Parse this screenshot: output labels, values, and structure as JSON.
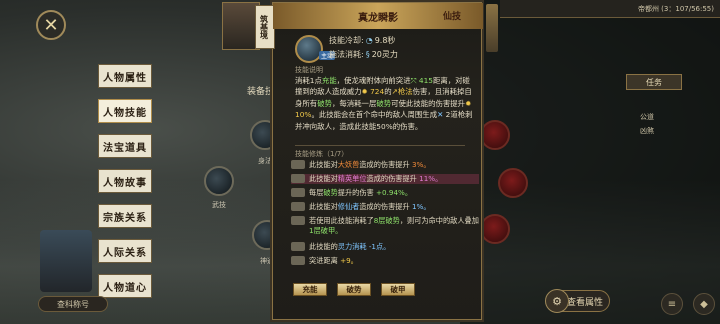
{
  "close_icon": "✕",
  "tabs": [
    "人物属性",
    "人物技能",
    "法宝道具",
    "人物故事",
    "宗族关系",
    "人际关系",
    "人物道心"
  ],
  "equip_label": "装备技",
  "left_skills": [
    {
      "label": "身法"
    },
    {
      "label": "武技"
    },
    {
      "label": "神通"
    }
  ],
  "portrait_label": "查科称号",
  "topbar_text": "帝都州 (3：107/56:55)",
  "task_label": "任务",
  "side_items": [
    "公道",
    "凶煞"
  ],
  "view_attr_label": "查看属性",
  "popup": {
    "realm": "筑基境",
    "title": "真龙瞬影",
    "tier": "仙技",
    "cooldown_label": "技能冷却:",
    "cooldown_value": "9.8秒",
    "cost_label": "施法消耗:",
    "cost_value": "20灵力",
    "active_tag": "主动",
    "desc_title": "技能说明",
    "desc": {
      "p1": "消耗1点",
      "p2": "充能",
      "p3": "，使龙魂附体向前突进",
      "p4": "415",
      "p5": "距离，对碰撞到的敌人造成威力",
      "p6": "724",
      "p7": "的",
      "p8": "枪法",
      "p9": "伤害，且消耗掉自身所有",
      "p10": "破势",
      "p11": "，每消耗一层",
      "p12": "破势",
      "p13": "可使此技能的伤害提升",
      "p14": "10%",
      "p15": "。此技能会在首个命中的敌人周围生成",
      "p16": "2",
      "p17": "道枪刺并冲向敌人，造成此技能50%的伤害。"
    },
    "ins_title": "技能修炼（1/7）",
    "inscriptions": [
      {
        "pre": "此技能对",
        "key": "大妖兽",
        "post": "造成的伤害提升",
        "val": "3%。",
        "cls": "o"
      },
      {
        "pre": "此技能对",
        "key": "精英单位",
        "post": "造成的伤害提升",
        "val": "11%。",
        "cls": "m",
        "hl": true
      },
      {
        "pre": "每层",
        "key": "破势",
        "post": "提升的伤害",
        "val": "+0.94%。",
        "cls": "g"
      },
      {
        "pre": "此技能对",
        "key": "修仙者",
        "post": "造成的伤害提升",
        "val": "1%。",
        "cls": "b"
      },
      {
        "pre": "若使用此技能消耗了",
        "key": "8层破势",
        "post": "，则可为命中的敌人叠加",
        "val": "1层破甲。",
        "cls": "g"
      },
      {
        "pre": "此技能的",
        "key": "灵力消耗",
        "post": "",
        "val": "-1点。",
        "cls": "b"
      },
      {
        "pre": "突进距离",
        "key": "",
        "post": "",
        "val": "+9。",
        "cls": "y"
      }
    ],
    "buttons": [
      "充能",
      "破势",
      "破甲"
    ]
  }
}
